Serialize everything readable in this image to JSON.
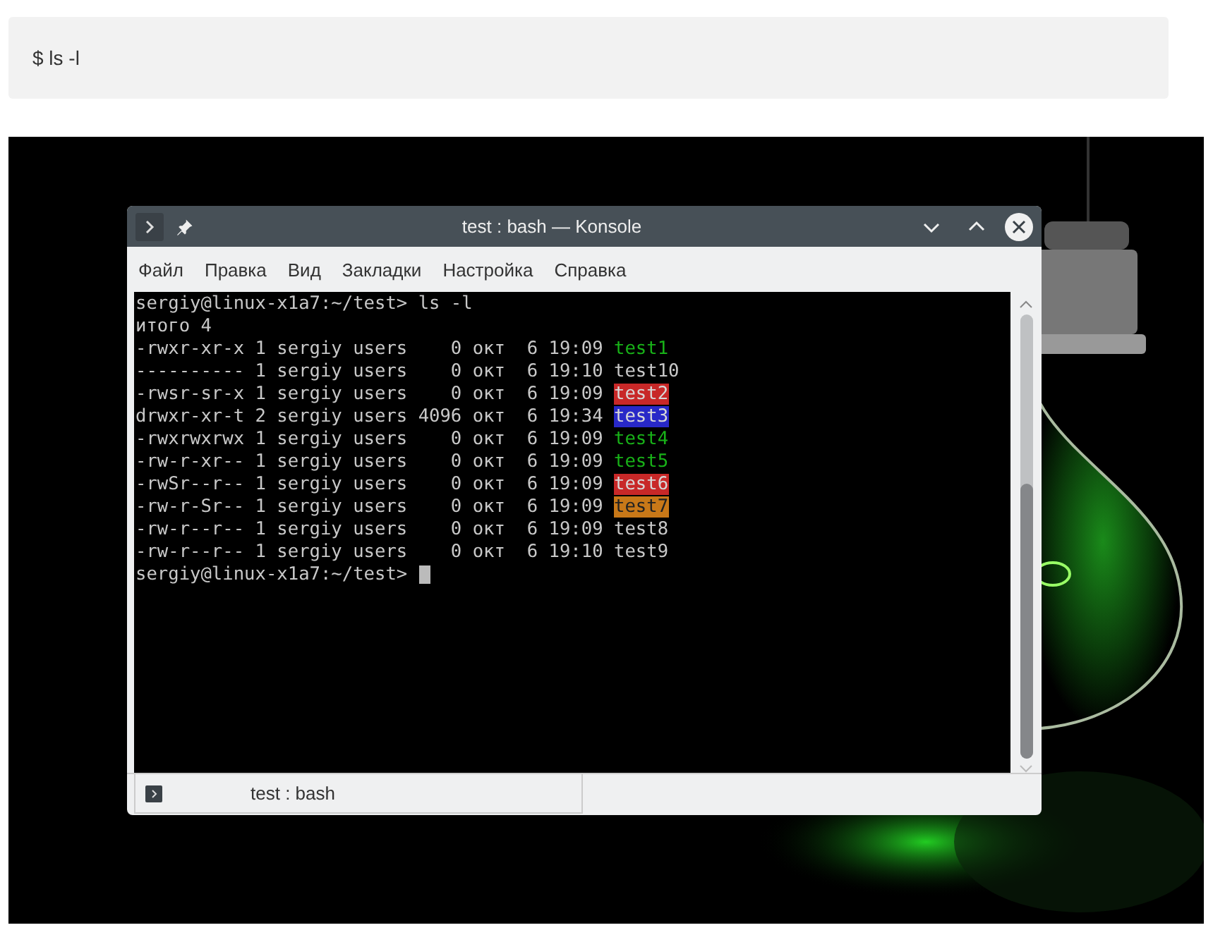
{
  "code_block": {
    "text": "$ ls -l"
  },
  "window": {
    "title": "test : bash — Konsole"
  },
  "menu": [
    "Файл",
    "Правка",
    "Вид",
    "Закладки",
    "Настройка",
    "Справка"
  ],
  "terminal": {
    "command_line": "sergiy@linux-x1a7:~/test> ls -l",
    "total": "итого 4",
    "rows": [
      {
        "info": "-rwxr-xr-x 1 sergiy users    0 окт  6 19:09 ",
        "name": "test1",
        "kind": "exec"
      },
      {
        "info": "---------- 1 sergiy users    0 окт  6 19:10 ",
        "name": "test10",
        "kind": "plain"
      },
      {
        "info": "-rwsr-sr-x 1 sergiy users    0 окт  6 19:09 ",
        "name": "test2",
        "kind": "setuid"
      },
      {
        "info": "drwxr-xr-t 2 sergiy users 4096 окт  6 19:34 ",
        "name": "test3",
        "kind": "dir"
      },
      {
        "info": "-rwxrwxrwx 1 sergiy users    0 окт  6 19:09 ",
        "name": "test4",
        "kind": "exec"
      },
      {
        "info": "-rw-r-xr-- 1 sergiy users    0 окт  6 19:09 ",
        "name": "test5",
        "kind": "exec"
      },
      {
        "info": "-rwSr--r-- 1 sergiy users    0 окт  6 19:09 ",
        "name": "test6",
        "kind": "setuid"
      },
      {
        "info": "-rw-r-Sr-- 1 sergiy users    0 окт  6 19:09 ",
        "name": "test7",
        "kind": "setgid"
      },
      {
        "info": "-rw-r--r-- 1 sergiy users    0 окт  6 19:09 ",
        "name": "test8",
        "kind": "plain"
      },
      {
        "info": "-rw-r--r-- 1 sergiy users    0 окт  6 19:10 ",
        "name": "test9",
        "kind": "plain"
      }
    ],
    "prompt": "sergiy@linux-x1a7:~/test>"
  },
  "tabs": [
    {
      "label": "test : bash",
      "selected": true
    }
  ]
}
